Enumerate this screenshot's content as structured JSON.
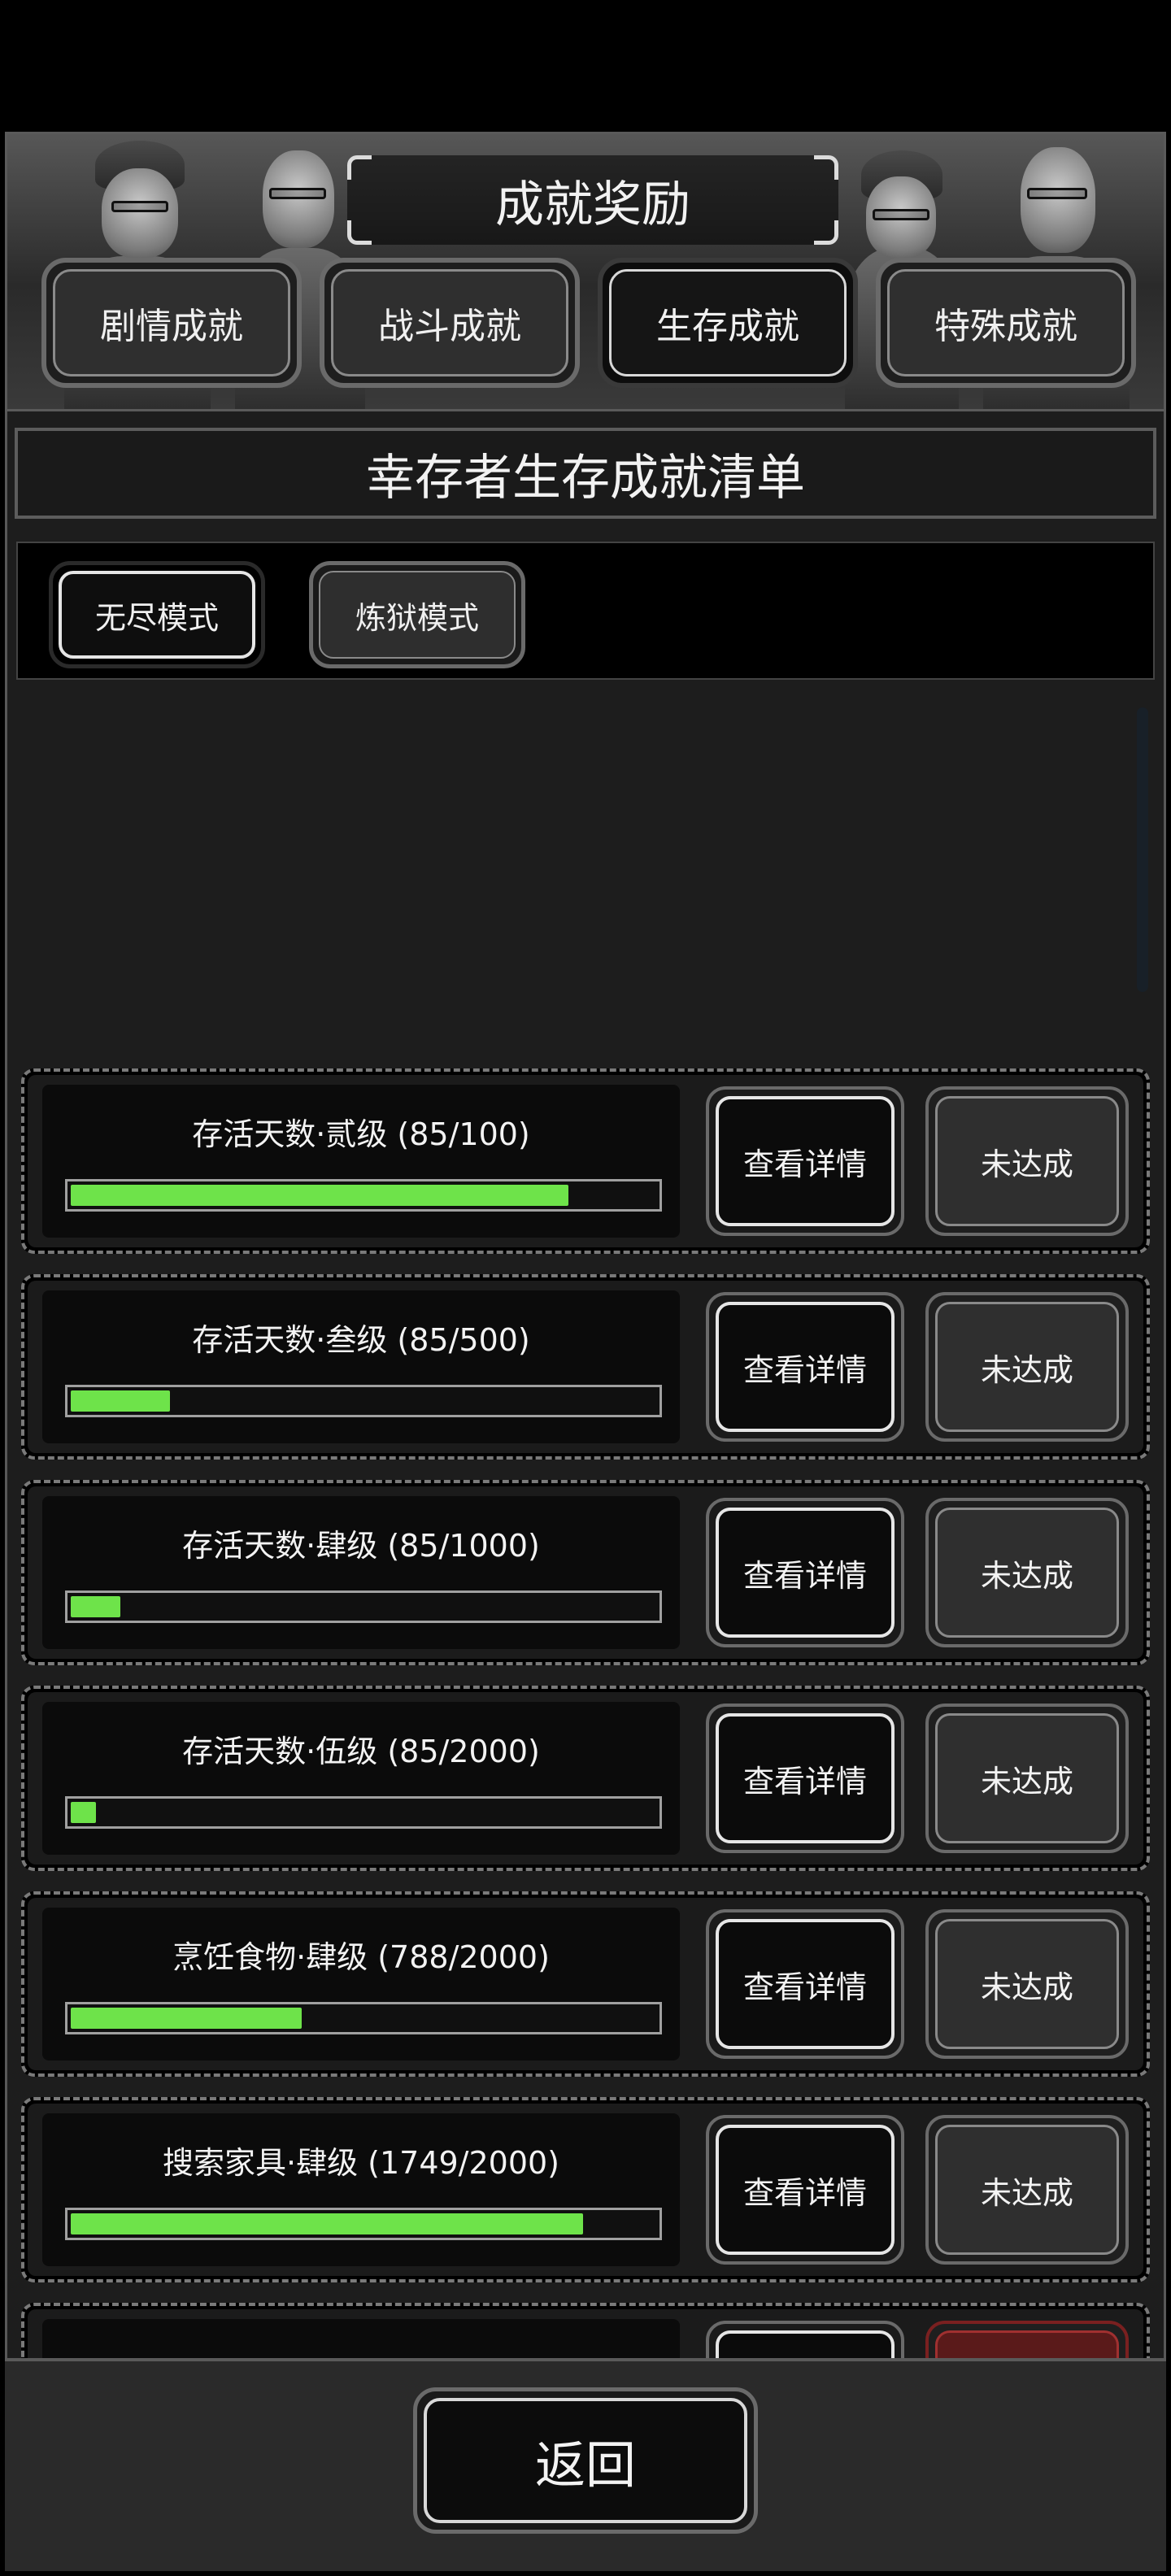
{
  "title": "成就奖励",
  "tabs": [
    {
      "label": "剧情成就",
      "active": false
    },
    {
      "label": "战斗成就",
      "active": false
    },
    {
      "label": "生存成就",
      "active": true
    },
    {
      "label": "特殊成就",
      "active": false
    }
  ],
  "section_title": "幸存者生存成就清单",
  "modes": [
    {
      "label": "无尽模式",
      "active": true
    },
    {
      "label": "炼狱模式",
      "active": false
    }
  ],
  "achievements": [
    {
      "label": "存活天数·贰级 (85/100)",
      "progress": 0.85,
      "detail_label": "查看详情",
      "status_label": "未达成"
    },
    {
      "label": "存活天数·叁级 (85/500)",
      "progress": 0.17,
      "detail_label": "查看详情",
      "status_label": "未达成"
    },
    {
      "label": "存活天数·肆级 (85/1000)",
      "progress": 0.085,
      "detail_label": "查看详情",
      "status_label": "未达成"
    },
    {
      "label": "存活天数·伍级 (85/2000)",
      "progress": 0.0425,
      "detail_label": "查看详情",
      "status_label": "未达成"
    },
    {
      "label": "烹饪食物·肆级 (788/2000)",
      "progress": 0.394,
      "detail_label": "查看详情",
      "status_label": "未达成"
    },
    {
      "label": "搜索家具·肆级 (1749/2000)",
      "progress": 0.8745,
      "detail_label": "查看详情",
      "status_label": "未达成"
    }
  ],
  "back_label": "返回",
  "colors": {
    "progress_fill": "#6ee34a",
    "background": "#1d1d1d",
    "panel": "#0b0b0b"
  }
}
